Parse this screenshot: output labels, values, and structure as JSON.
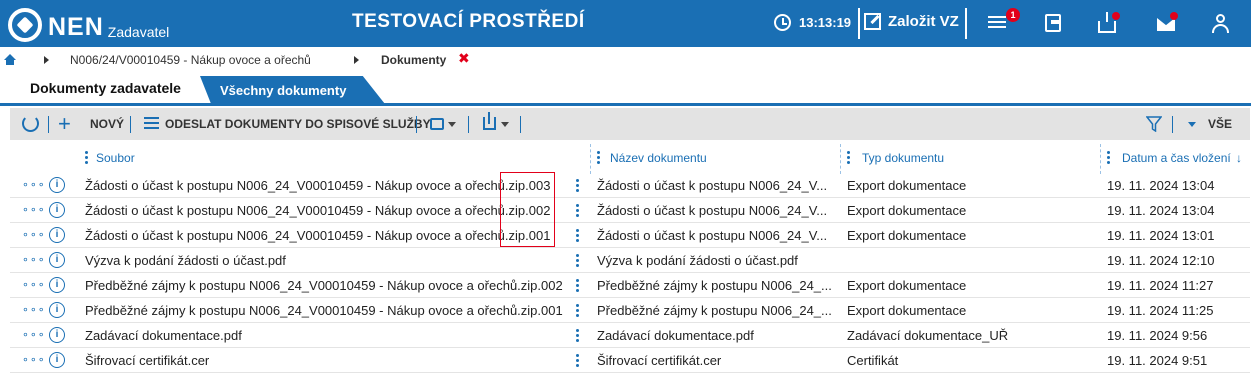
{
  "header": {
    "logo_text": "NEN",
    "logo_subtitle": "Zadavatel",
    "environment_title": "TESTOVACÍ PROSTŘEDÍ",
    "clock_time": "13:13:19",
    "create_vz_label": "Založit VZ",
    "menu_badge_count": "1",
    "accent_color": "#1a6fb4",
    "alert_color": "#e2001a"
  },
  "breadcrumb": {
    "items": [
      "N006/24/V00010459 - Nákup ovoce a ořechů",
      "Dokumenty"
    ]
  },
  "tabs": [
    {
      "label": "Dokumenty zadavatele",
      "active": true
    },
    {
      "label": "Všechny dokumenty",
      "active": false
    }
  ],
  "toolbar": {
    "new_label": "NOVÝ",
    "send_label": "ODESLAT DOKUMENTY DO SPISOVÉ SLUŽBY",
    "filter_scope_label": "VŠE"
  },
  "table": {
    "columns": [
      "Soubor",
      "Název dokumentu",
      "Typ dokumentu",
      "Datum a čas vložení"
    ],
    "sort_indicator": "↓",
    "rows": [
      {
        "file": "Žádosti o účast k postupu N006_24_V00010459 - Nákup ovoce a ořechů.zip.003",
        "name": "Žádosti o účast k postupu N006_24_V...",
        "type": "Export dokumentace",
        "date": "19. 11. 2024 13:04"
      },
      {
        "file": "Žádosti o účast k postupu N006_24_V00010459 - Nákup ovoce a ořechů.zip.002",
        "name": "Žádosti o účast k postupu N006_24_V...",
        "type": "Export dokumentace",
        "date": "19. 11. 2024 13:04"
      },
      {
        "file": "Žádosti o účast k postupu N006_24_V00010459 - Nákup ovoce a ořechů.zip.001",
        "name": "Žádosti o účast k postupu N006_24_V...",
        "type": "Export dokumentace",
        "date": "19. 11. 2024 13:01"
      },
      {
        "file": "Výzva k podání žádosti o účast.pdf",
        "name": "Výzva k podání žádosti o účast.pdf",
        "type": "",
        "date": "19. 11. 2024 12:10"
      },
      {
        "file": "Předběžné zájmy k postupu N006_24_V00010459 - Nákup ovoce a ořechů.zip.002",
        "name": "Předběžné zájmy k postupu N006_24_...",
        "type": "Export dokumentace",
        "date": "19. 11. 2024 11:27"
      },
      {
        "file": "Předběžné zájmy k postupu N006_24_V00010459 - Nákup ovoce a ořechů.zip.001",
        "name": "Předběžné zájmy k postupu N006_24_...",
        "type": "Export dokumentace",
        "date": "19. 11. 2024 11:25"
      },
      {
        "file": "Zadávací dokumentace.pdf",
        "name": "Zadávací dokumentace.pdf",
        "type": "Zadávací dokumentace_UŘ",
        "date": "19. 11. 2024 9:56"
      },
      {
        "file": "Šifrovací certifikát.cer",
        "name": "Šifrovací certifikát.cer",
        "type": "Certifikát",
        "date": "19. 11. 2024 9:51"
      }
    ]
  }
}
